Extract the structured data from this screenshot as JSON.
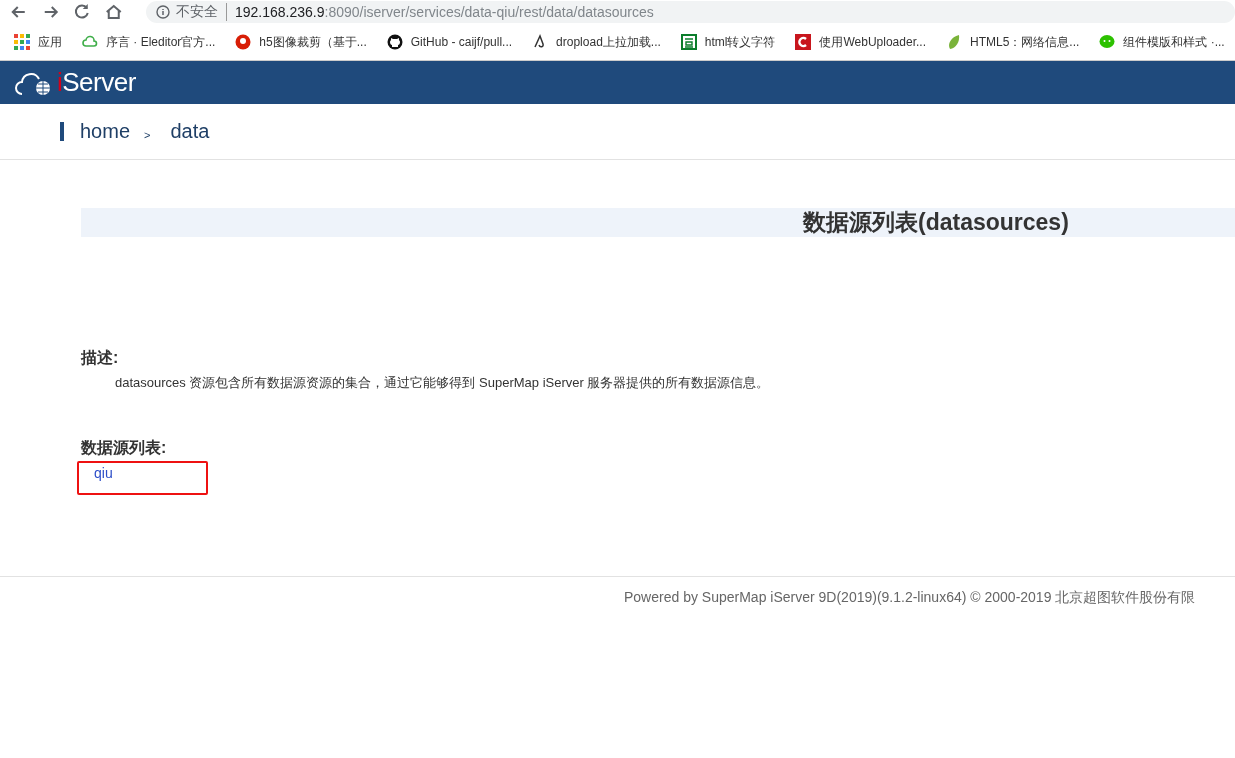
{
  "browser": {
    "security_label": "不安全",
    "url_host": "192.168.236.9",
    "url_path": ":8090/iserver/services/data-qiu/rest/data/datasources"
  },
  "bookmarks": [
    {
      "kind": "apps",
      "label": "应用"
    },
    {
      "kind": "cloud",
      "label": "序言 · Eleditor官方..."
    },
    {
      "kind": "redcircle",
      "label": "h5图像裁剪（基于..."
    },
    {
      "kind": "github",
      "label": "GitHub - caijf/pull..."
    },
    {
      "kind": "drop",
      "label": "dropload上拉加载..."
    },
    {
      "kind": "square",
      "label": "html转义字符"
    },
    {
      "kind": "redc",
      "label": "使用WebUploader..."
    },
    {
      "kind": "leaf",
      "label": "HTML5：网络信息..."
    },
    {
      "kind": "chat",
      "label": "组件模版和样式 ·..."
    }
  ],
  "header": {
    "logo_prefix": "i",
    "logo_text": "Server"
  },
  "breadcrumb": [
    {
      "label": "home"
    },
    {
      "label": "data"
    }
  ],
  "breadcrumb_separator": ">",
  "title": "数据源列表(datasources)",
  "description": {
    "heading": "描述:",
    "text": "datasources 资源包含所有数据源资源的集合，通过它能够得到 SuperMap iServer 服务器提供的所有数据源信息。"
  },
  "list": {
    "heading": "数据源列表:",
    "items": [
      {
        "label": "qiu"
      }
    ]
  },
  "footer": "Powered by SuperMap iServer 9D(2019)(9.1.2-linux64) © 2000-2019 北京超图软件股份有限"
}
